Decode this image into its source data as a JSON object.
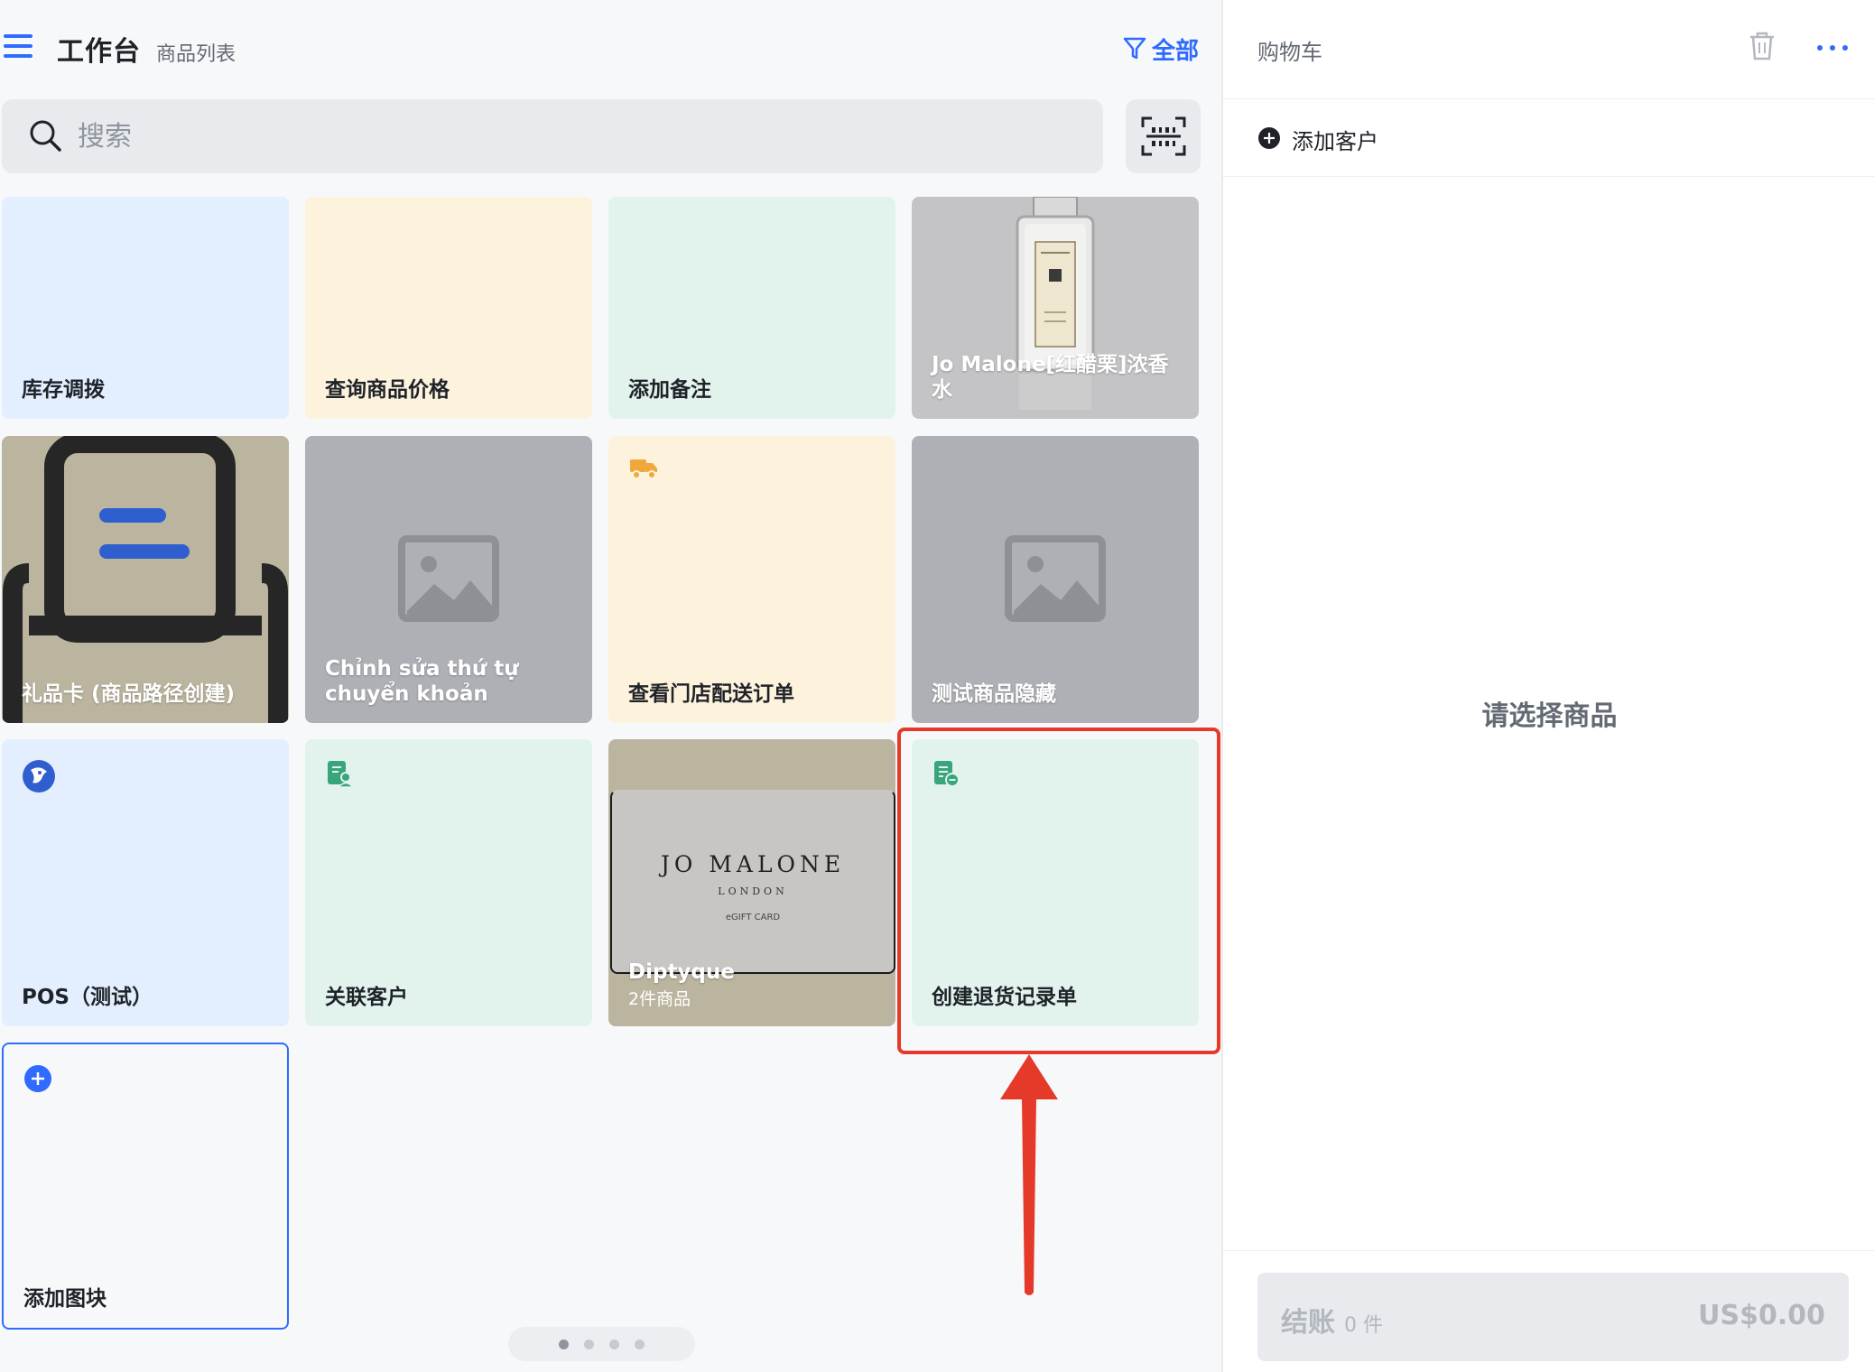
{
  "header": {
    "title": "工作台",
    "subtitle": "商品列表",
    "filter_label": "全部"
  },
  "search": {
    "placeholder": "搜索"
  },
  "tiles": [
    {
      "label": "库存调拨",
      "color": "#e3efff"
    },
    {
      "label": "查询商品价格",
      "color": "#fdf3dc"
    },
    {
      "label": "添加备注",
      "color": "#e2f3ee"
    },
    {
      "label": "Jo Malone[红醋栗]浓香水",
      "image": "perfume-bottle"
    },
    {
      "label": "礼品卡 (商品路径创建)",
      "image": "receipt-printer-icon"
    },
    {
      "label": "Chỉnh sửa thứ tự chuyển khoản",
      "image": "image-placeholder-icon"
    },
    {
      "label": "查看门店配送订单",
      "icon": "truck-icon",
      "color": "#fdf3dc"
    },
    {
      "label": "测试商品隐藏",
      "image": "image-placeholder-icon"
    },
    {
      "label": "POS（测试）",
      "icon": "app-logo-icon",
      "color": "#e3efff"
    },
    {
      "label": "关联客户",
      "icon": "customer-doc-icon",
      "color": "#e2f3ee"
    },
    {
      "label": "Diptyque",
      "sublabel": "2件商品",
      "image": "jo-malone-gift-card"
    },
    {
      "label": "创建退货记录单",
      "icon": "return-doc-icon",
      "color": "#e2f3ee"
    },
    {
      "label": "添加图块",
      "icon": "plus-circle-icon"
    }
  ],
  "gift_card": {
    "brand": "JO MALONE",
    "city": "LONDON",
    "card_type": "eGIFT CARD"
  },
  "pager": {
    "pages": 4,
    "active": 0
  },
  "cart": {
    "title": "购物车",
    "add_customer": "添加客户",
    "empty_text": "请选择商品",
    "checkout_label": "结账",
    "checkout_count": "0 件",
    "total": "US$0.00"
  },
  "colors": {
    "accent": "#2f6bff",
    "annotation": "#e53a2a"
  }
}
